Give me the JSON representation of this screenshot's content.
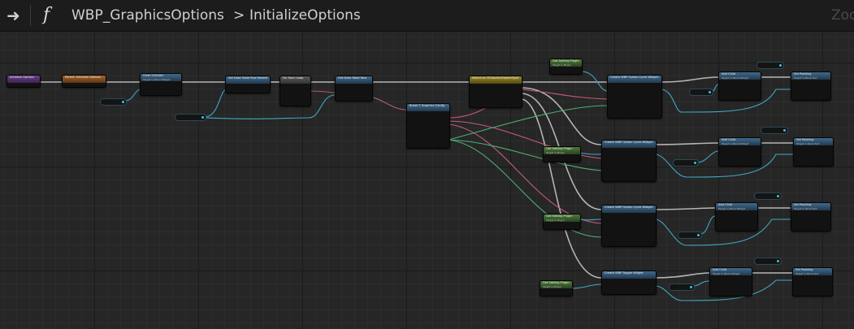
{
  "topbar": {
    "back_icon": "arrow-right-icon",
    "function_icon_glyph": "f",
    "blueprint_name": "WBP_GraphicsOptions",
    "chevron": ">",
    "function_name": "InitializeOptions",
    "zoom_label": "Zoom"
  },
  "graph": {
    "nodes": [
      {
        "id": "n-entry",
        "title": "Initialize Options",
        "subtitle": ""
      },
      {
        "id": "n-parent",
        "title": "Parent: Initialize Options",
        "subtitle": ""
      },
      {
        "id": "n-clear",
        "title": "Clear Children",
        "subtitle": "Target is Panel Widget"
      },
      {
        "id": "n-settable",
        "title": "Set Data Table Row Names",
        "subtitle": ""
      },
      {
        "id": "n-foreach",
        "title": "For Each Loop",
        "subtitle": ""
      },
      {
        "id": "n-getrow",
        "title": "Get Data Table Row",
        "subtitle": ""
      },
      {
        "id": "n-break",
        "title": "Break F Graphics Config",
        "subtitle": ""
      },
      {
        "id": "n-switch",
        "title": "Switch on EGraphicsOptionType",
        "subtitle": ""
      },
      {
        "id": "n-getset1",
        "title": "Get Setting Plugin",
        "subtitle": "Target is Plugin"
      },
      {
        "id": "n-create1",
        "title": "Create WBP Option Cycle Widget",
        "subtitle": ""
      },
      {
        "id": "n-add1",
        "title": "Add Child",
        "subtitle": "Target is Panel Widget"
      },
      {
        "id": "n-pad1",
        "title": "Set Padding",
        "subtitle": "Target is Panel Slot"
      },
      {
        "id": "n-getset2",
        "title": "Get Setting Plugin",
        "subtitle": "Target is Plugin"
      },
      {
        "id": "n-create2",
        "title": "Create WBP Option Cycle Widget",
        "subtitle": ""
      },
      {
        "id": "n-add2",
        "title": "Add Child",
        "subtitle": "Target is Panel Widget"
      },
      {
        "id": "n-pad2",
        "title": "Set Padding",
        "subtitle": "Target is Panel Slot"
      },
      {
        "id": "n-getset3",
        "title": "Get Setting Plugin",
        "subtitle": "Target is Plugin"
      },
      {
        "id": "n-create3",
        "title": "Create WBP Option Cycle Widget",
        "subtitle": ""
      },
      {
        "id": "n-add3",
        "title": "Add Child",
        "subtitle": "Target is Panel Widget"
      },
      {
        "id": "n-pad3",
        "title": "Set Padding",
        "subtitle": "Target is Panel Slot"
      },
      {
        "id": "n-getset4",
        "title": "Get Setting Plugin",
        "subtitle": "Target is Plugin"
      },
      {
        "id": "n-create4",
        "title": "Create WBP Toggle Widget",
        "subtitle": ""
      },
      {
        "id": "n-add4",
        "title": "Add Child",
        "subtitle": "Target is Panel Widget"
      },
      {
        "id": "n-pad4",
        "title": "Set Padding",
        "subtitle": "Target is Panel Slot"
      }
    ]
  },
  "colors": {
    "background": "#262626",
    "topbar": "#1c1c1c",
    "exec_wire": "#d8d8d8",
    "data_wire_blue": "#3fa9c4",
    "data_wire_pink": "#c85a7a",
    "data_wire_green": "#4fae73"
  }
}
